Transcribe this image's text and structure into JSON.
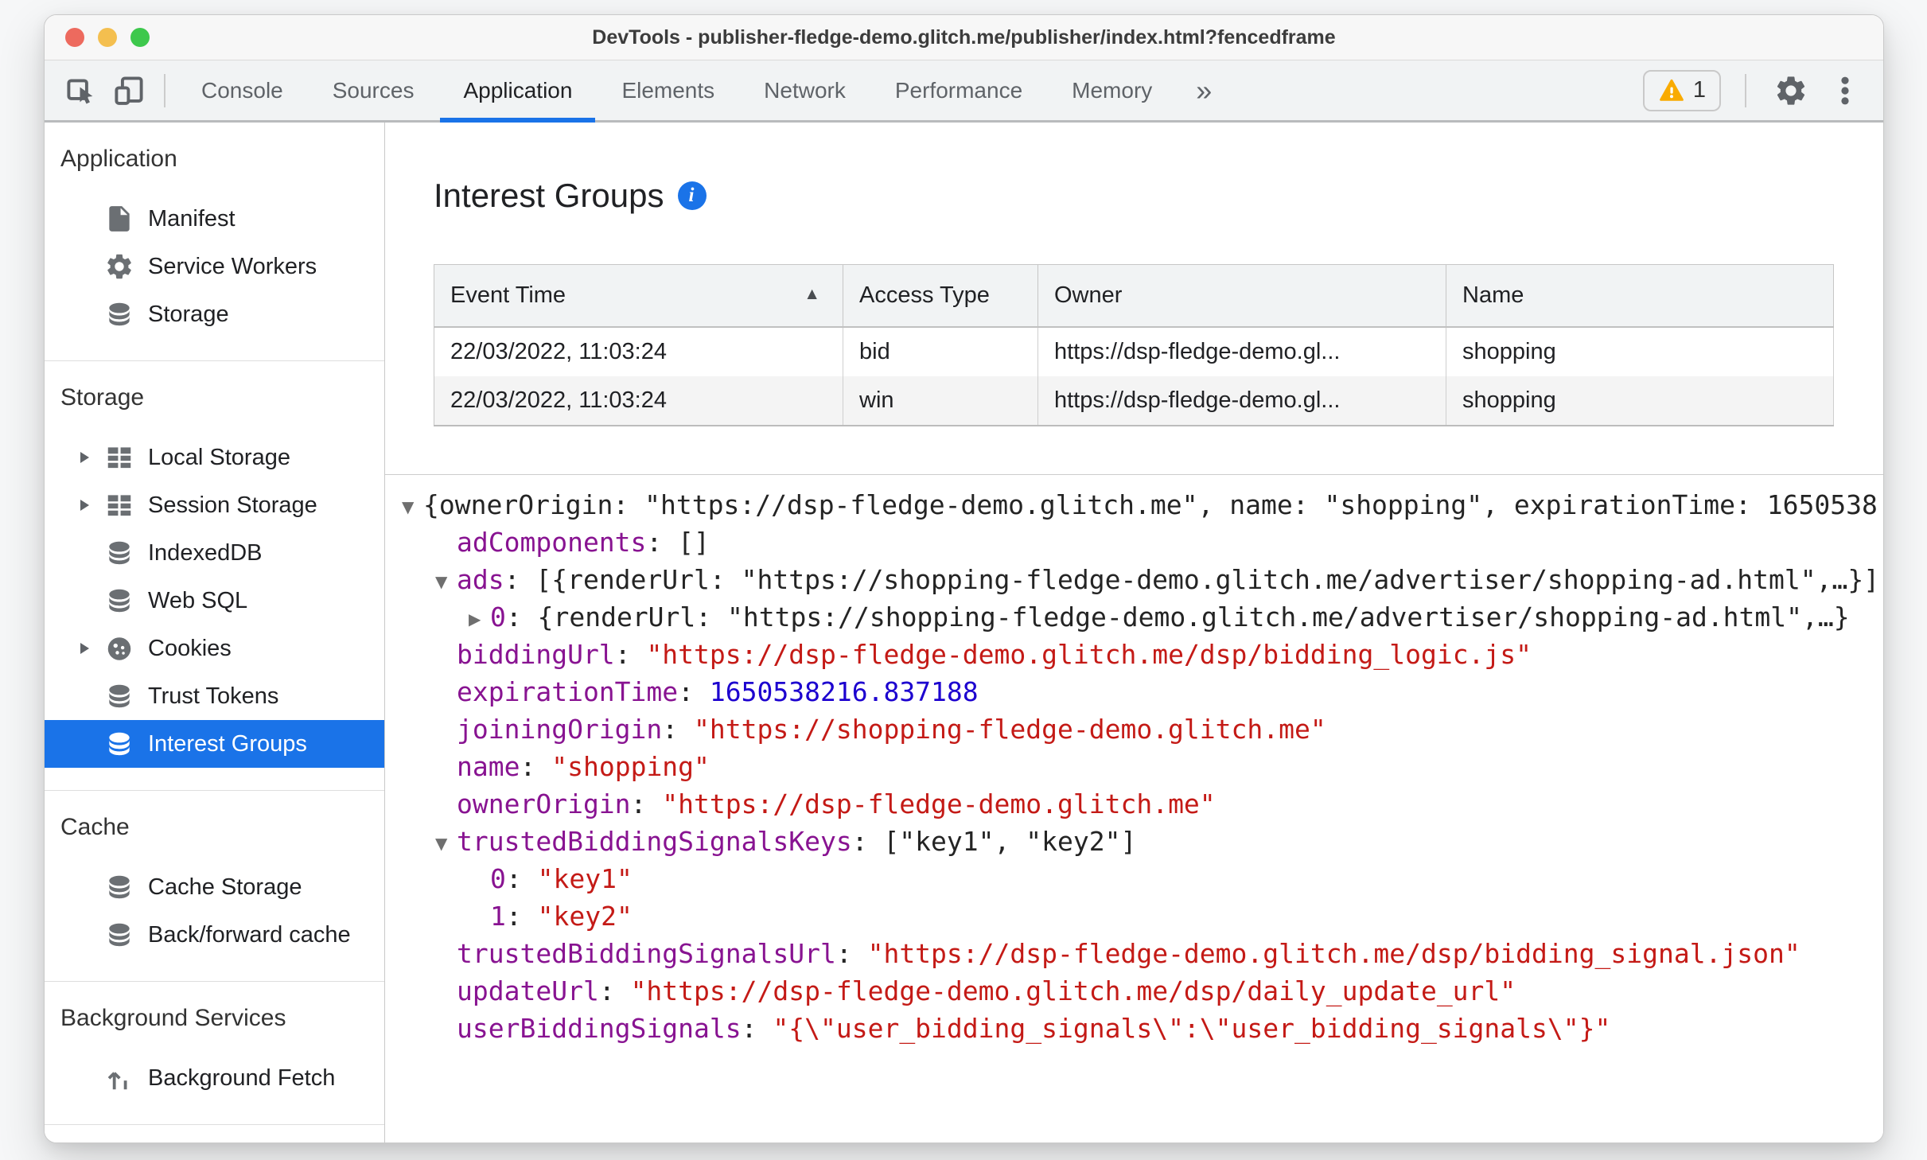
{
  "window": {
    "title": "DevTools - publisher-fledge-demo.glitch.me/publisher/index.html?fencedframe",
    "controls": [
      "close",
      "minimize",
      "zoom"
    ]
  },
  "toolbar": {
    "tabs": [
      {
        "label": "Console"
      },
      {
        "label": "Sources"
      },
      {
        "label": "Application",
        "active": true
      },
      {
        "label": "Elements"
      },
      {
        "label": "Network"
      },
      {
        "label": "Performance"
      },
      {
        "label": "Memory"
      }
    ],
    "more_tabs_symbol": "»",
    "warning_count": "1",
    "icons": [
      "inspect-icon",
      "device-toolbar-icon",
      "warning-icon",
      "gear-icon",
      "three-dot-menu-icon"
    ]
  },
  "sidebar": {
    "sections": [
      {
        "header": "Application",
        "items": [
          {
            "label": "Manifest",
            "icon": "document-icon"
          },
          {
            "label": "Service Workers",
            "icon": "gear-icon"
          },
          {
            "label": "Storage",
            "icon": "database-icon"
          }
        ]
      },
      {
        "header": "Storage",
        "items": [
          {
            "label": "Local Storage",
            "icon": "table-icon",
            "expander": true
          },
          {
            "label": "Session Storage",
            "icon": "table-icon",
            "expander": true
          },
          {
            "label": "IndexedDB",
            "icon": "database-icon"
          },
          {
            "label": "Web SQL",
            "icon": "database-icon"
          },
          {
            "label": "Cookies",
            "icon": "cookie-icon",
            "expander": true
          },
          {
            "label": "Trust Tokens",
            "icon": "database-icon"
          },
          {
            "label": "Interest Groups",
            "icon": "database-icon",
            "selected": true
          }
        ]
      },
      {
        "header": "Cache",
        "items": [
          {
            "label": "Cache Storage",
            "icon": "database-icon"
          },
          {
            "label": "Back/forward cache",
            "icon": "database-icon"
          }
        ]
      },
      {
        "header": "Background Services",
        "items": [
          {
            "label": "Background Fetch",
            "icon": "fetch-icon"
          }
        ]
      }
    ]
  },
  "main": {
    "title": "Interest Groups",
    "info_icon": "info-icon",
    "table": {
      "sort_symbol": "▲",
      "columns": [
        {
          "label": "Event Time",
          "sorted": "asc"
        },
        {
          "label": "Access Type"
        },
        {
          "label": "Owner"
        },
        {
          "label": "Name"
        }
      ],
      "rows": [
        [
          "22/03/2022, 11:03:24",
          "bid",
          "https://dsp-fledge-demo.gl...",
          "shopping"
        ],
        [
          "22/03/2022, 11:03:24",
          "win",
          "https://dsp-fledge-demo.gl...",
          "shopping"
        ]
      ]
    },
    "tree": [
      {
        "indent": 0,
        "expander": "open",
        "parts": [
          {
            "type": "plain",
            "text": "{ownerOrigin: \"https://dsp-fledge-demo.glitch.me\", name: \"shopping\", expirationTime: 1650538"
          }
        ]
      },
      {
        "indent": 1,
        "expander": null,
        "parts": [
          {
            "type": "key",
            "text": "adComponents"
          },
          {
            "type": "plain",
            "text": ": []"
          }
        ]
      },
      {
        "indent": 1,
        "expander": "open",
        "parts": [
          {
            "type": "key",
            "text": "ads"
          },
          {
            "type": "plain",
            "text": ": [{renderUrl: \"https://shopping-fledge-demo.glitch.me/advertiser/shopping-ad.html\",…}]"
          }
        ]
      },
      {
        "indent": 2,
        "expander": "closed",
        "parts": [
          {
            "type": "key",
            "text": "0"
          },
          {
            "type": "plain",
            "text": ": {renderUrl: \"https://shopping-fledge-demo.glitch.me/advertiser/shopping-ad.html\",…}"
          }
        ]
      },
      {
        "indent": 1,
        "expander": null,
        "parts": [
          {
            "type": "key",
            "text": "biddingUrl"
          },
          {
            "type": "plain",
            "text": ": "
          },
          {
            "type": "string",
            "text": "\"https://dsp-fledge-demo.glitch.me/dsp/bidding_logic.js\""
          }
        ]
      },
      {
        "indent": 1,
        "expander": null,
        "parts": [
          {
            "type": "key",
            "text": "expirationTime"
          },
          {
            "type": "plain",
            "text": ": "
          },
          {
            "type": "number",
            "text": "1650538216.837188"
          }
        ]
      },
      {
        "indent": 1,
        "expander": null,
        "parts": [
          {
            "type": "key",
            "text": "joiningOrigin"
          },
          {
            "type": "plain",
            "text": ": "
          },
          {
            "type": "string",
            "text": "\"https://shopping-fledge-demo.glitch.me\""
          }
        ]
      },
      {
        "indent": 1,
        "expander": null,
        "parts": [
          {
            "type": "key",
            "text": "name"
          },
          {
            "type": "plain",
            "text": ": "
          },
          {
            "type": "string",
            "text": "\"shopping\""
          }
        ]
      },
      {
        "indent": 1,
        "expander": null,
        "parts": [
          {
            "type": "key",
            "text": "ownerOrigin"
          },
          {
            "type": "plain",
            "text": ": "
          },
          {
            "type": "string",
            "text": "\"https://dsp-fledge-demo.glitch.me\""
          }
        ]
      },
      {
        "indent": 1,
        "expander": "open",
        "parts": [
          {
            "type": "key",
            "text": "trustedBiddingSignalsKeys"
          },
          {
            "type": "plain",
            "text": ": [\"key1\", \"key2\"]"
          }
        ]
      },
      {
        "indent": 2,
        "expander": null,
        "parts": [
          {
            "type": "key",
            "text": "0"
          },
          {
            "type": "plain",
            "text": ": "
          },
          {
            "type": "string",
            "text": "\"key1\""
          }
        ]
      },
      {
        "indent": 2,
        "expander": null,
        "parts": [
          {
            "type": "key",
            "text": "1"
          },
          {
            "type": "plain",
            "text": ": "
          },
          {
            "type": "string",
            "text": "\"key2\""
          }
        ]
      },
      {
        "indent": 1,
        "expander": null,
        "parts": [
          {
            "type": "key",
            "text": "trustedBiddingSignalsUrl"
          },
          {
            "type": "plain",
            "text": ": "
          },
          {
            "type": "string",
            "text": "\"https://dsp-fledge-demo.glitch.me/dsp/bidding_signal.json\""
          }
        ]
      },
      {
        "indent": 1,
        "expander": null,
        "parts": [
          {
            "type": "key",
            "text": "updateUrl"
          },
          {
            "type": "plain",
            "text": ": "
          },
          {
            "type": "string",
            "text": "\"https://dsp-fledge-demo.glitch.me/dsp/daily_update_url\""
          }
        ]
      },
      {
        "indent": 1,
        "expander": null,
        "parts": [
          {
            "type": "key",
            "text": "userBiddingSignals"
          },
          {
            "type": "plain",
            "text": ": "
          },
          {
            "type": "string",
            "text": "\"{\\\"user_bidding_signals\\\":\\\"user_bidding_signals\\\"}\""
          }
        ]
      }
    ]
  },
  "colors": {
    "accent_blue": "#1a73e8",
    "selection_blue": "#1a73e8",
    "json_key_purple": "#881391",
    "json_string_red": "#c41a16",
    "json_number_blue": "#1c00cf",
    "warning_yellow": "#f9ab00",
    "traffic_red": "#ed6a5e",
    "traffic_yellow": "#f4bf4f",
    "traffic_green": "#3dc84c"
  }
}
